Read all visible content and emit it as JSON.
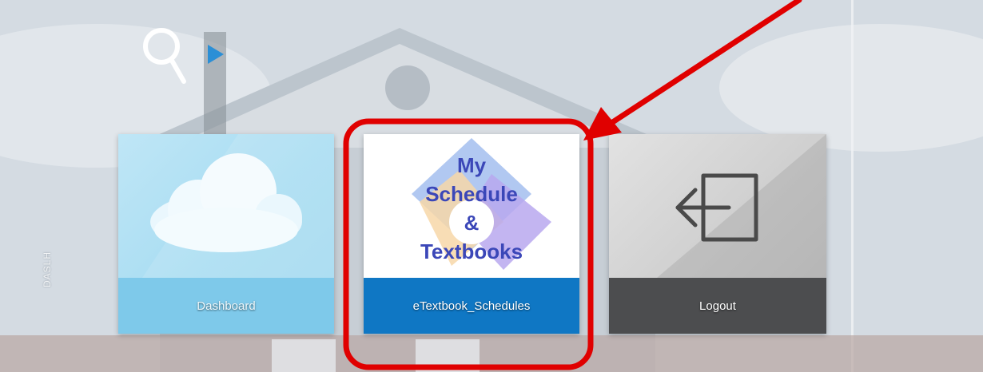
{
  "background": {
    "description_icon": "house-photo-background"
  },
  "side_label": "DASLH",
  "search": {
    "icon": "search-icon",
    "arrow_icon": "play-arrow-icon"
  },
  "tiles": [
    {
      "label": "Dashboard",
      "icon": "cloud-icon",
      "bar_color": "#7ec9ea"
    },
    {
      "label": "eTextbook_Schedules",
      "icon": "schedule-logo",
      "logo_lines": [
        "My",
        "Schedule",
        "&",
        "Textbooks"
      ],
      "bar_color": "#0f77c4"
    },
    {
      "label": "Logout",
      "icon": "logout-icon",
      "bar_color": "#4c4d4f"
    }
  ],
  "annotation": {
    "highlight_color": "#e00000",
    "type": "red-box-and-arrow"
  }
}
